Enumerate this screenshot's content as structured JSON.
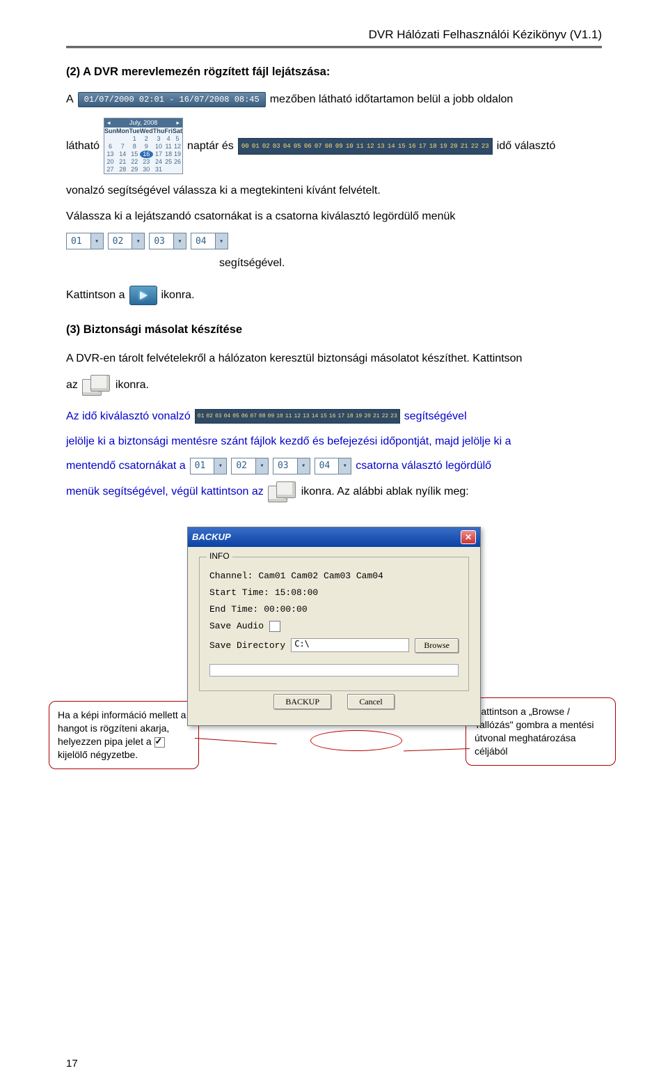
{
  "header": {
    "title": "DVR Hálózati Felhasználói Kézikönyv (V1.1)"
  },
  "s2": {
    "title": "(2) A DVR merevlemezén rögzített fájl lejátszása:",
    "l1a": "A",
    "daterange": "01/07/2000 02:01 - 16/07/2008 08:45",
    "l1b": "mezőben látható időtartamon belül a jobb oldalon",
    "l2a": "látható",
    "calmonth": "July, 2008",
    "days": [
      "Sun",
      "Mon",
      "Tue",
      "Wed",
      "Thu",
      "Fri",
      "Sat"
    ],
    "l2b": "naptár és",
    "hours": [
      "00",
      "01",
      "02",
      "03",
      "04",
      "05",
      "06",
      "07",
      "08",
      "09",
      "10",
      "11",
      "12",
      "13",
      "14",
      "15",
      "16",
      "17",
      "18",
      "19",
      "20",
      "21",
      "22",
      "23"
    ],
    "l2c": "idő választó",
    "l3": "vonalzó segítségével válassza ki a megtekinteni kívánt felvételt.",
    "l4": "Válassza ki a lejátszandó csatornákat is a csatorna kiválasztó legördülő menük",
    "ch": [
      "01",
      "02",
      "03",
      "04"
    ],
    "l5": "segítségével.",
    "l6a": "Kattintson a",
    "l6b": "ikonra."
  },
  "s3": {
    "title": "(3) Biztonsági másolat készítése",
    "p1a": "A DVR-en tárolt felvételekről a hálózaton keresztül biztonsági másolatot készíthet. Kattintson",
    "p1b": "az",
    "p1c": "ikonra.",
    "p2a": "Az idő kiválasztó vonalzó",
    "hours": [
      "01",
      "02",
      "03",
      "04",
      "05",
      "06",
      "07",
      "08",
      "09",
      "10",
      "11",
      "12",
      "13",
      "14",
      "15",
      "16",
      "17",
      "18",
      "19",
      "20",
      "21",
      "22",
      "23"
    ],
    "p2b": "segítségével",
    "p2c": "jelölje ki a biztonsági mentésre szánt fájlok kezdő és befejezési időpontját, majd jelölje ki a",
    "p3a": "mentendő csatornákat a",
    "ch": [
      "01",
      "02",
      "03",
      "04"
    ],
    "p3b": "csatorna választó legördülő",
    "p4a": "menük segítségével, végül kattintson az",
    "p4b": "ikonra. Az alábbi ablak nyílik meg:"
  },
  "dlg": {
    "title": "BACKUP",
    "legend": "INFO",
    "ch_lbl": "Channel:",
    "ch_val": "Cam01 Cam02 Cam03 Cam04",
    "st_lbl": "Start Time:",
    "st_val": "15:08:00",
    "et_lbl": "End Time:",
    "et_val": "00:00:00",
    "sa_lbl": "Save Audio",
    "sd_lbl": "Save Directory",
    "sd_val": "C:\\",
    "browse": "Browse",
    "backup": "BACKUP",
    "cancel": "Cancel"
  },
  "callouts": {
    "left_a": "Ha a képi információ mellett a hangot is rögzíteni akarja, helyezzen pipa jelet a",
    "left_b": "kijelölő négyzetbe.",
    "right": "Kattintson a „Browse / Tallózás\" gombra a mentési útvonal meghatározása céljából"
  },
  "pagenum": "17"
}
